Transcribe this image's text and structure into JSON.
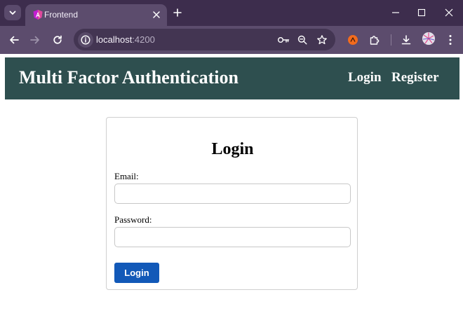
{
  "browser": {
    "tab": {
      "title": "Frontend"
    },
    "address_bar": {
      "host": "localhost",
      "port": ":4200"
    }
  },
  "header": {
    "title": "Multi Factor Authentication",
    "nav": [
      {
        "label": "Login"
      },
      {
        "label": "Register"
      }
    ]
  },
  "login_form": {
    "heading": "Login",
    "email": {
      "label": "Email:",
      "value": "",
      "placeholder": ""
    },
    "password": {
      "label": "Password:",
      "value": "",
      "placeholder": ""
    },
    "submit_label": "Login"
  },
  "colors": {
    "header_bg": "#2e4f4f",
    "button_bg": "#1259b8",
    "chrome_tabstrip": "#3d2d4d",
    "chrome_toolbar": "#5c4c6d"
  }
}
